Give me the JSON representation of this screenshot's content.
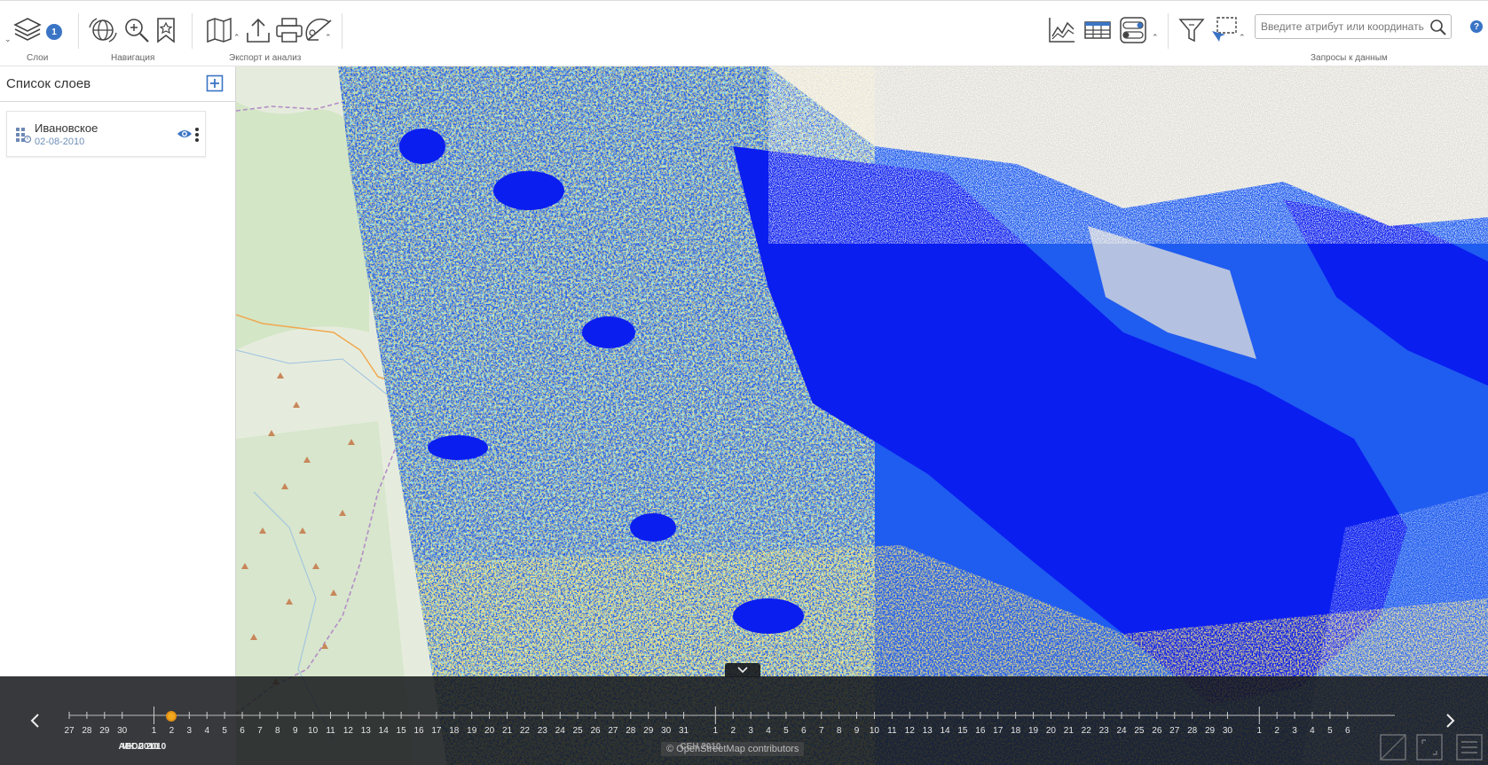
{
  "toolbar": {
    "groups": {
      "layers_label": "Слои",
      "navigation_label": "Навигация",
      "export_label": "Экспорт и анализ",
      "data_label": "Запросы к данным"
    },
    "layers_badge": "1",
    "search": {
      "placeholder": "Введите атрибут или координаты",
      "value": ""
    },
    "help": "?"
  },
  "sidebar": {
    "title": "Список слоев",
    "layers": [
      {
        "name": "Ивановское",
        "date": "02-08-2010"
      }
    ]
  },
  "timeline": {
    "july_days": [
      "27",
      "28",
      "29",
      "30"
    ],
    "august_days": [
      "1",
      "2",
      "3",
      "4",
      "5",
      "6",
      "7",
      "8",
      "9",
      "10",
      "11",
      "12",
      "13",
      "14",
      "15",
      "16",
      "17",
      "18",
      "19",
      "20",
      "21",
      "22",
      "23",
      "24",
      "25",
      "26",
      "27",
      "28",
      "29",
      "30",
      "31"
    ],
    "september_days_a": [
      "1",
      "2",
      "3",
      "4",
      "5",
      "6",
      "7",
      "8",
      "9",
      "10",
      "11",
      "12",
      "13",
      "14",
      "15",
      "16",
      "17",
      "18",
      "19",
      "20",
      "21",
      "22",
      "23",
      "24",
      "25",
      "26",
      "27",
      "28",
      "29",
      "30"
    ],
    "october_days": [
      "1",
      "2",
      "3",
      "4",
      "5",
      "6"
    ],
    "month_labels": {
      "jul": "ИЮЛ 2010",
      "aug": "АВГ 2010",
      "sep": "СЕН 2010"
    },
    "selected_day": "2",
    "attribution": "© OpenStreetMap contributors"
  },
  "colors": {
    "accent": "#3a74c5",
    "map_deep": "#0a1ef0",
    "map_mid": "#2a8cf0",
    "map_light": "#4ad0f0",
    "map_yellow": "#e8d040",
    "map_orange": "#e09030",
    "timeline_thumb": "#f2a81d"
  }
}
